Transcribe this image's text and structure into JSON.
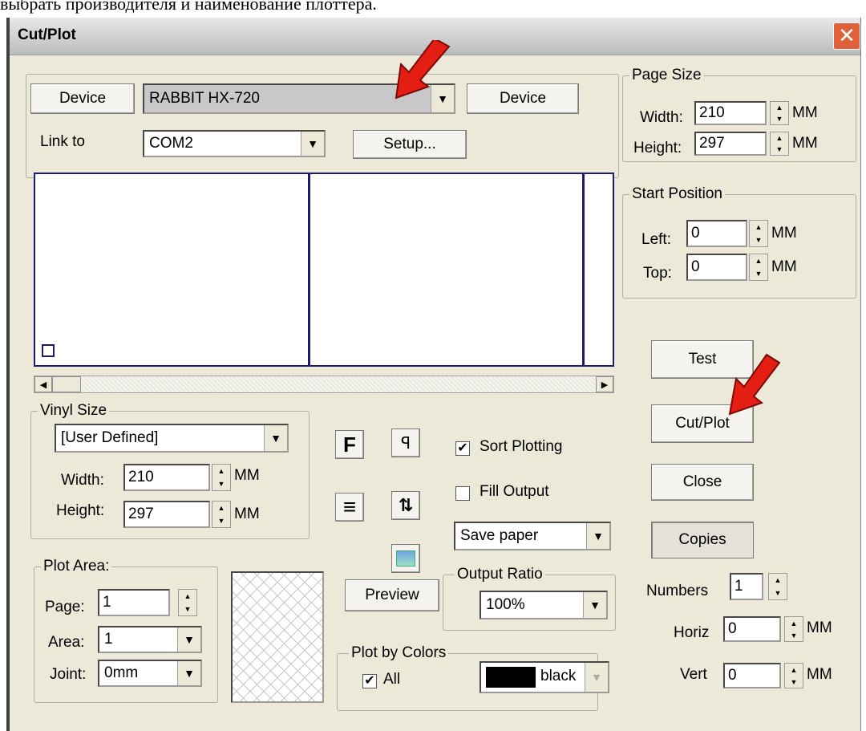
{
  "caption": "выбрать производителя и наименование плоттера.",
  "window": {
    "title": "Cut/Plot",
    "close_icon": "close-icon"
  },
  "device": {
    "left_button": "Device",
    "model": "RABBIT HX-720",
    "right_button": "Device"
  },
  "link": {
    "label": "Link to",
    "port": "COM2",
    "setup_button": "Setup..."
  },
  "page_size": {
    "group": "Page Size",
    "width_label": "Width:",
    "width": "210",
    "height_label": "Height:",
    "height": "297",
    "unit": "MM"
  },
  "start_position": {
    "group": "Start Position",
    "left_label": "Left:",
    "left": "0",
    "top_label": "Top:",
    "top": "0",
    "unit": "MM"
  },
  "vinyl": {
    "group": "Vinyl Size",
    "preset": "[User Defined]",
    "width_label": "Width:",
    "width": "210",
    "height_label": "Height:",
    "height": "297",
    "unit": "MM"
  },
  "plot_area": {
    "group": "Plot Area:",
    "page_label": "Page:",
    "page": "1",
    "area_label": "Area:",
    "area": "1",
    "joint_label": "Joint:",
    "joint": "0mm"
  },
  "options": {
    "sort_plotting": "Sort Plotting",
    "sort_checked": true,
    "fill_output": "Fill Output",
    "fill_checked": false,
    "save_paper": "Save paper"
  },
  "output_ratio": {
    "group": "Output Ratio",
    "value": "100%"
  },
  "preview_button": "Preview",
  "plot_by_colors": {
    "group": "Plot by Colors",
    "all_label": "All",
    "all_checked": true,
    "color_name": "black",
    "swatch": "#000000"
  },
  "buttons": {
    "test": "Test",
    "cut_plot": "Cut/Plot",
    "close": "Close",
    "copies": "Copies"
  },
  "copies": {
    "numbers_label": "Numbers",
    "numbers": "1",
    "horiz_label": "Horiz",
    "horiz": "0",
    "vert_label": "Vert",
    "vert": "0",
    "unit": "MM"
  },
  "colors": {
    "annotation_arrow": "#e41e12",
    "preview_border": "#1a1a6e"
  }
}
